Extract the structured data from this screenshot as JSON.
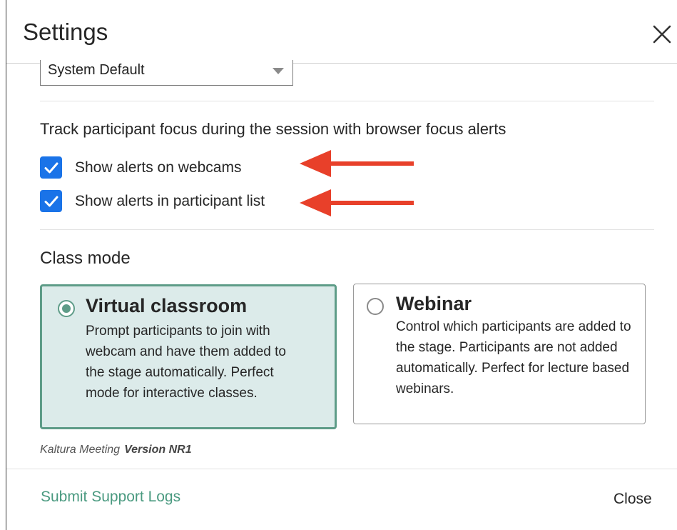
{
  "header": {
    "title": "Settings",
    "close_icon": "close-icon"
  },
  "display_select": {
    "value": "System Default"
  },
  "focus_alerts": {
    "title": "Track participant focus during the session with browser focus alerts",
    "options": [
      {
        "label": "Show alerts on webcams",
        "checked": true
      },
      {
        "label": "Show alerts in participant list",
        "checked": true
      }
    ]
  },
  "class_mode": {
    "title": "Class mode",
    "options": [
      {
        "title": "Virtual classroom",
        "description": "Prompt participants to join with webcam and have them added to the stage automatically. Perfect mode for interactive classes.",
        "selected": true
      },
      {
        "title": "Webinar",
        "description": "Control which participants are added to the stage. Participants are not added automatically. Perfect for lecture based webinars.",
        "selected": false
      }
    ]
  },
  "version": {
    "product": "Kaltura Meeting",
    "version_label": "Version NR1"
  },
  "footer": {
    "support_link": "Submit Support Logs",
    "close_label": "Close"
  },
  "colors": {
    "accent": "#5e9c88",
    "checkbox": "#1a73e8",
    "annotation_arrow": "#e8402a"
  }
}
